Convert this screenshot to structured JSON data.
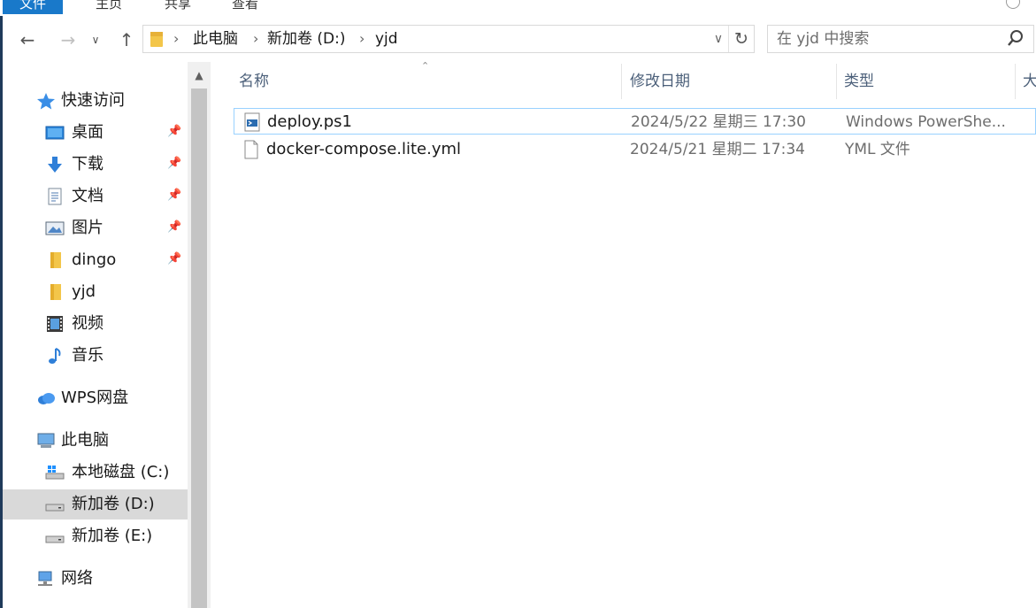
{
  "ribbon": {
    "tabs": [
      "文件",
      "主页",
      "共享",
      "查看"
    ]
  },
  "address": {
    "crumbs": [
      "此电脑",
      "新加卷 (D:)",
      "yjd"
    ]
  },
  "search": {
    "placeholder": "在 yjd 中搜索"
  },
  "sidebar": {
    "quick_access": "快速访问",
    "items": [
      {
        "label": "桌面",
        "icon": "desktop-icon",
        "pinned": true
      },
      {
        "label": "下载",
        "icon": "download-icon",
        "pinned": true
      },
      {
        "label": "文档",
        "icon": "documents-icon",
        "pinned": true
      },
      {
        "label": "图片",
        "icon": "pictures-icon",
        "pinned": true
      },
      {
        "label": "dingo",
        "icon": "folder-icon",
        "pinned": true
      },
      {
        "label": "yjd",
        "icon": "folder-icon",
        "pinned": false
      },
      {
        "label": "视频",
        "icon": "videos-icon",
        "pinned": false
      },
      {
        "label": "音乐",
        "icon": "music-icon",
        "pinned": false
      }
    ],
    "wps": "WPS网盘",
    "this_pc": "此电脑",
    "drives": [
      {
        "label": "本地磁盘 (C:)",
        "icon": "windows-drive-icon"
      },
      {
        "label": "新加卷 (D:)",
        "icon": "drive-icon",
        "selected": true
      },
      {
        "label": "新加卷 (E:)",
        "icon": "drive-icon"
      }
    ],
    "network": "网络"
  },
  "columns": {
    "name": "名称",
    "modified": "修改日期",
    "type": "类型",
    "size": "大"
  },
  "files": [
    {
      "name": "deploy.ps1",
      "modified": "2024/5/22 星期三 17:30",
      "type": "Windows PowerShe...",
      "icon": "powershell-script-icon",
      "selected": true
    },
    {
      "name": "docker-compose.lite.yml",
      "modified": "2024/5/21 星期二 17:34",
      "type": "YML 文件",
      "icon": "file-icon",
      "selected": false
    }
  ],
  "colors": {
    "accent": "#1979ca",
    "selection_border": "#99d1ff",
    "header_text": "#4c607a",
    "nav_selected": "#d9d9d9"
  }
}
